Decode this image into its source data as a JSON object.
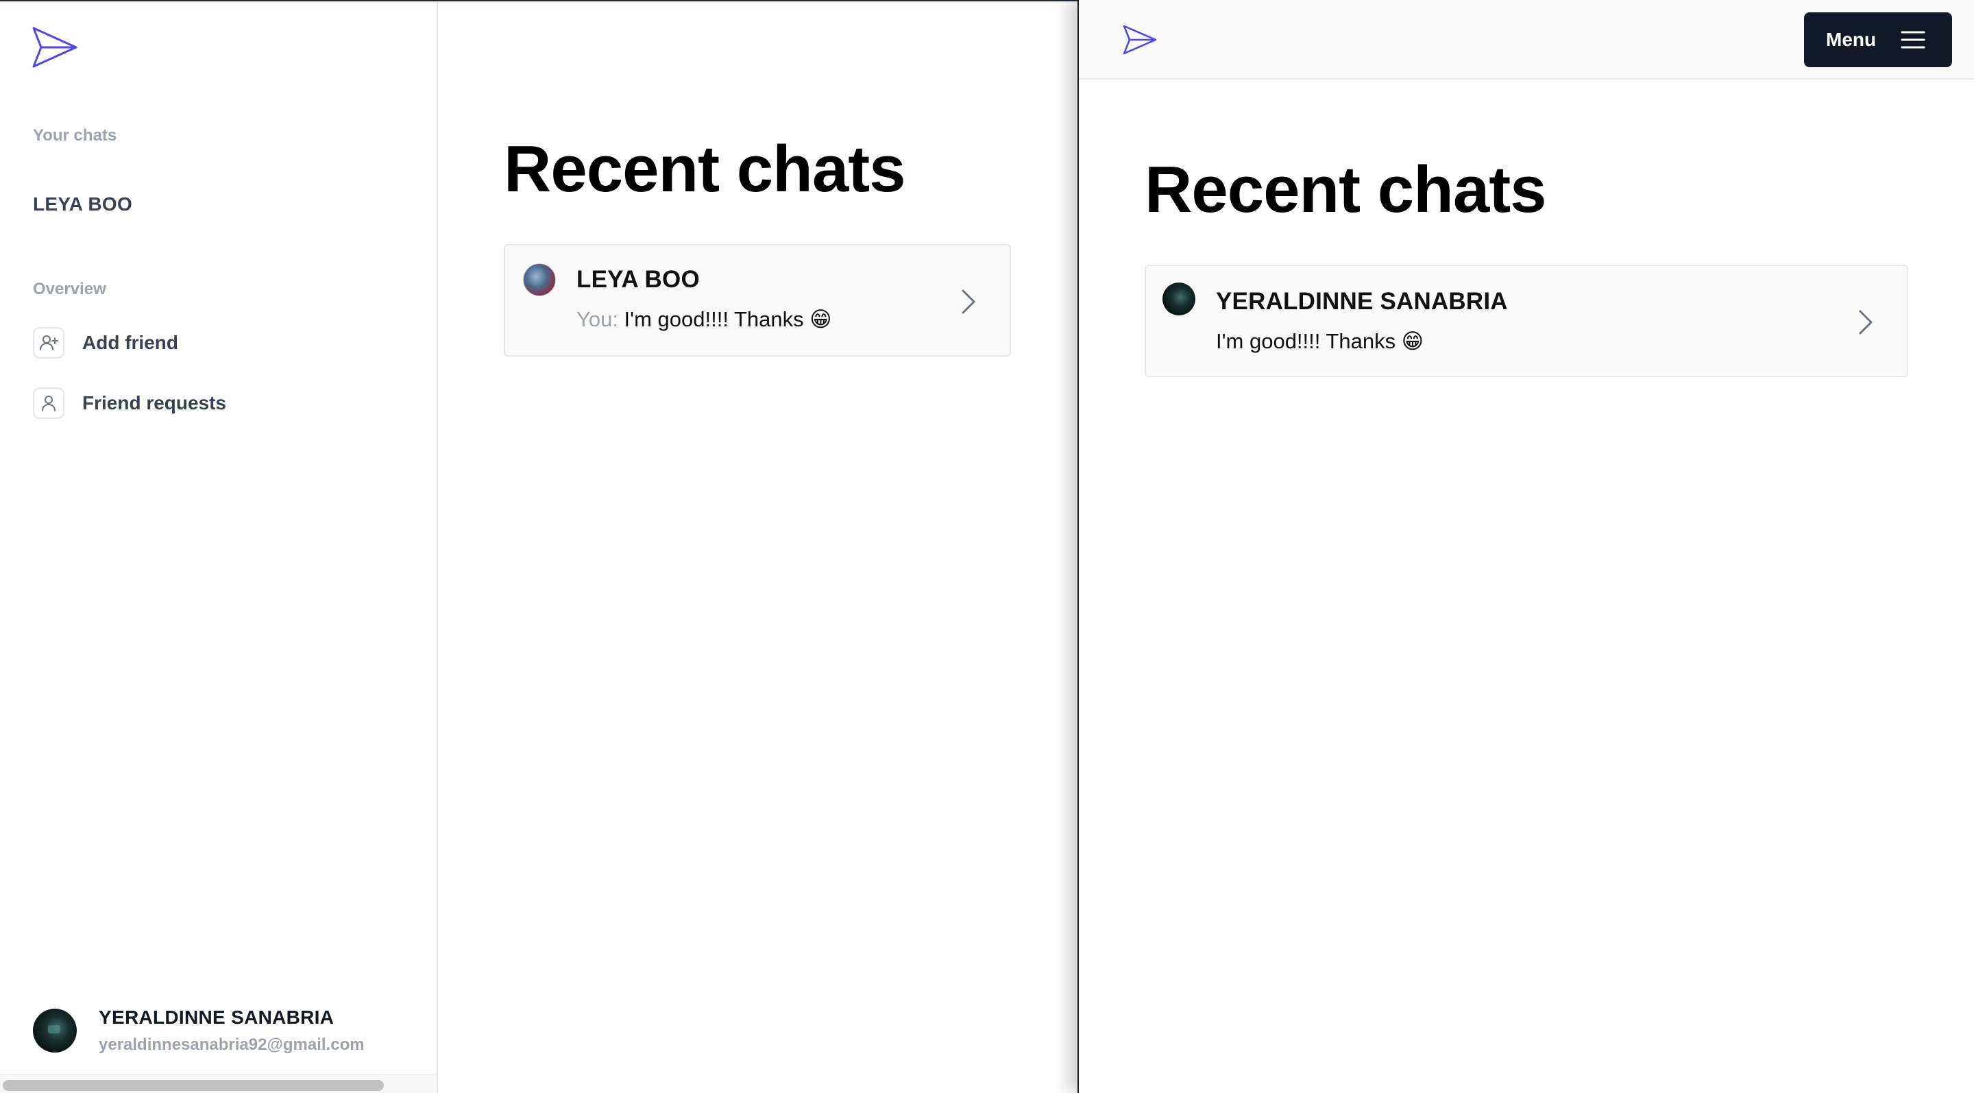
{
  "left": {
    "sidebar": {
      "your_chats_label": "Your chats",
      "chats": [
        {
          "name": "LEYA BOO"
        }
      ],
      "overview_label": "Overview",
      "nav": [
        {
          "label": "Add friend",
          "icon": "user-plus-icon"
        },
        {
          "label": "Friend requests",
          "icon": "user-icon"
        }
      ],
      "user": {
        "name": "YERALDINNE SANABRIA",
        "email": "yeraldinnesanabria92@gmail.com"
      }
    },
    "main": {
      "heading": "Recent chats",
      "chats": [
        {
          "name": "LEYA BOO",
          "prefix": "You: ",
          "message": "I'm good!!!! Thanks 😁"
        }
      ]
    }
  },
  "right": {
    "topbar": {
      "menu_label": "Menu"
    },
    "main": {
      "heading": "Recent chats",
      "chats": [
        {
          "name": "YERALDINNE SANABRIA",
          "message": "I'm good!!!! Thanks 😁"
        }
      ]
    }
  },
  "colors": {
    "brand": "#4f46e5",
    "dark": "#111827",
    "muted": "#9ca3af",
    "border": "#e5e7eb"
  }
}
